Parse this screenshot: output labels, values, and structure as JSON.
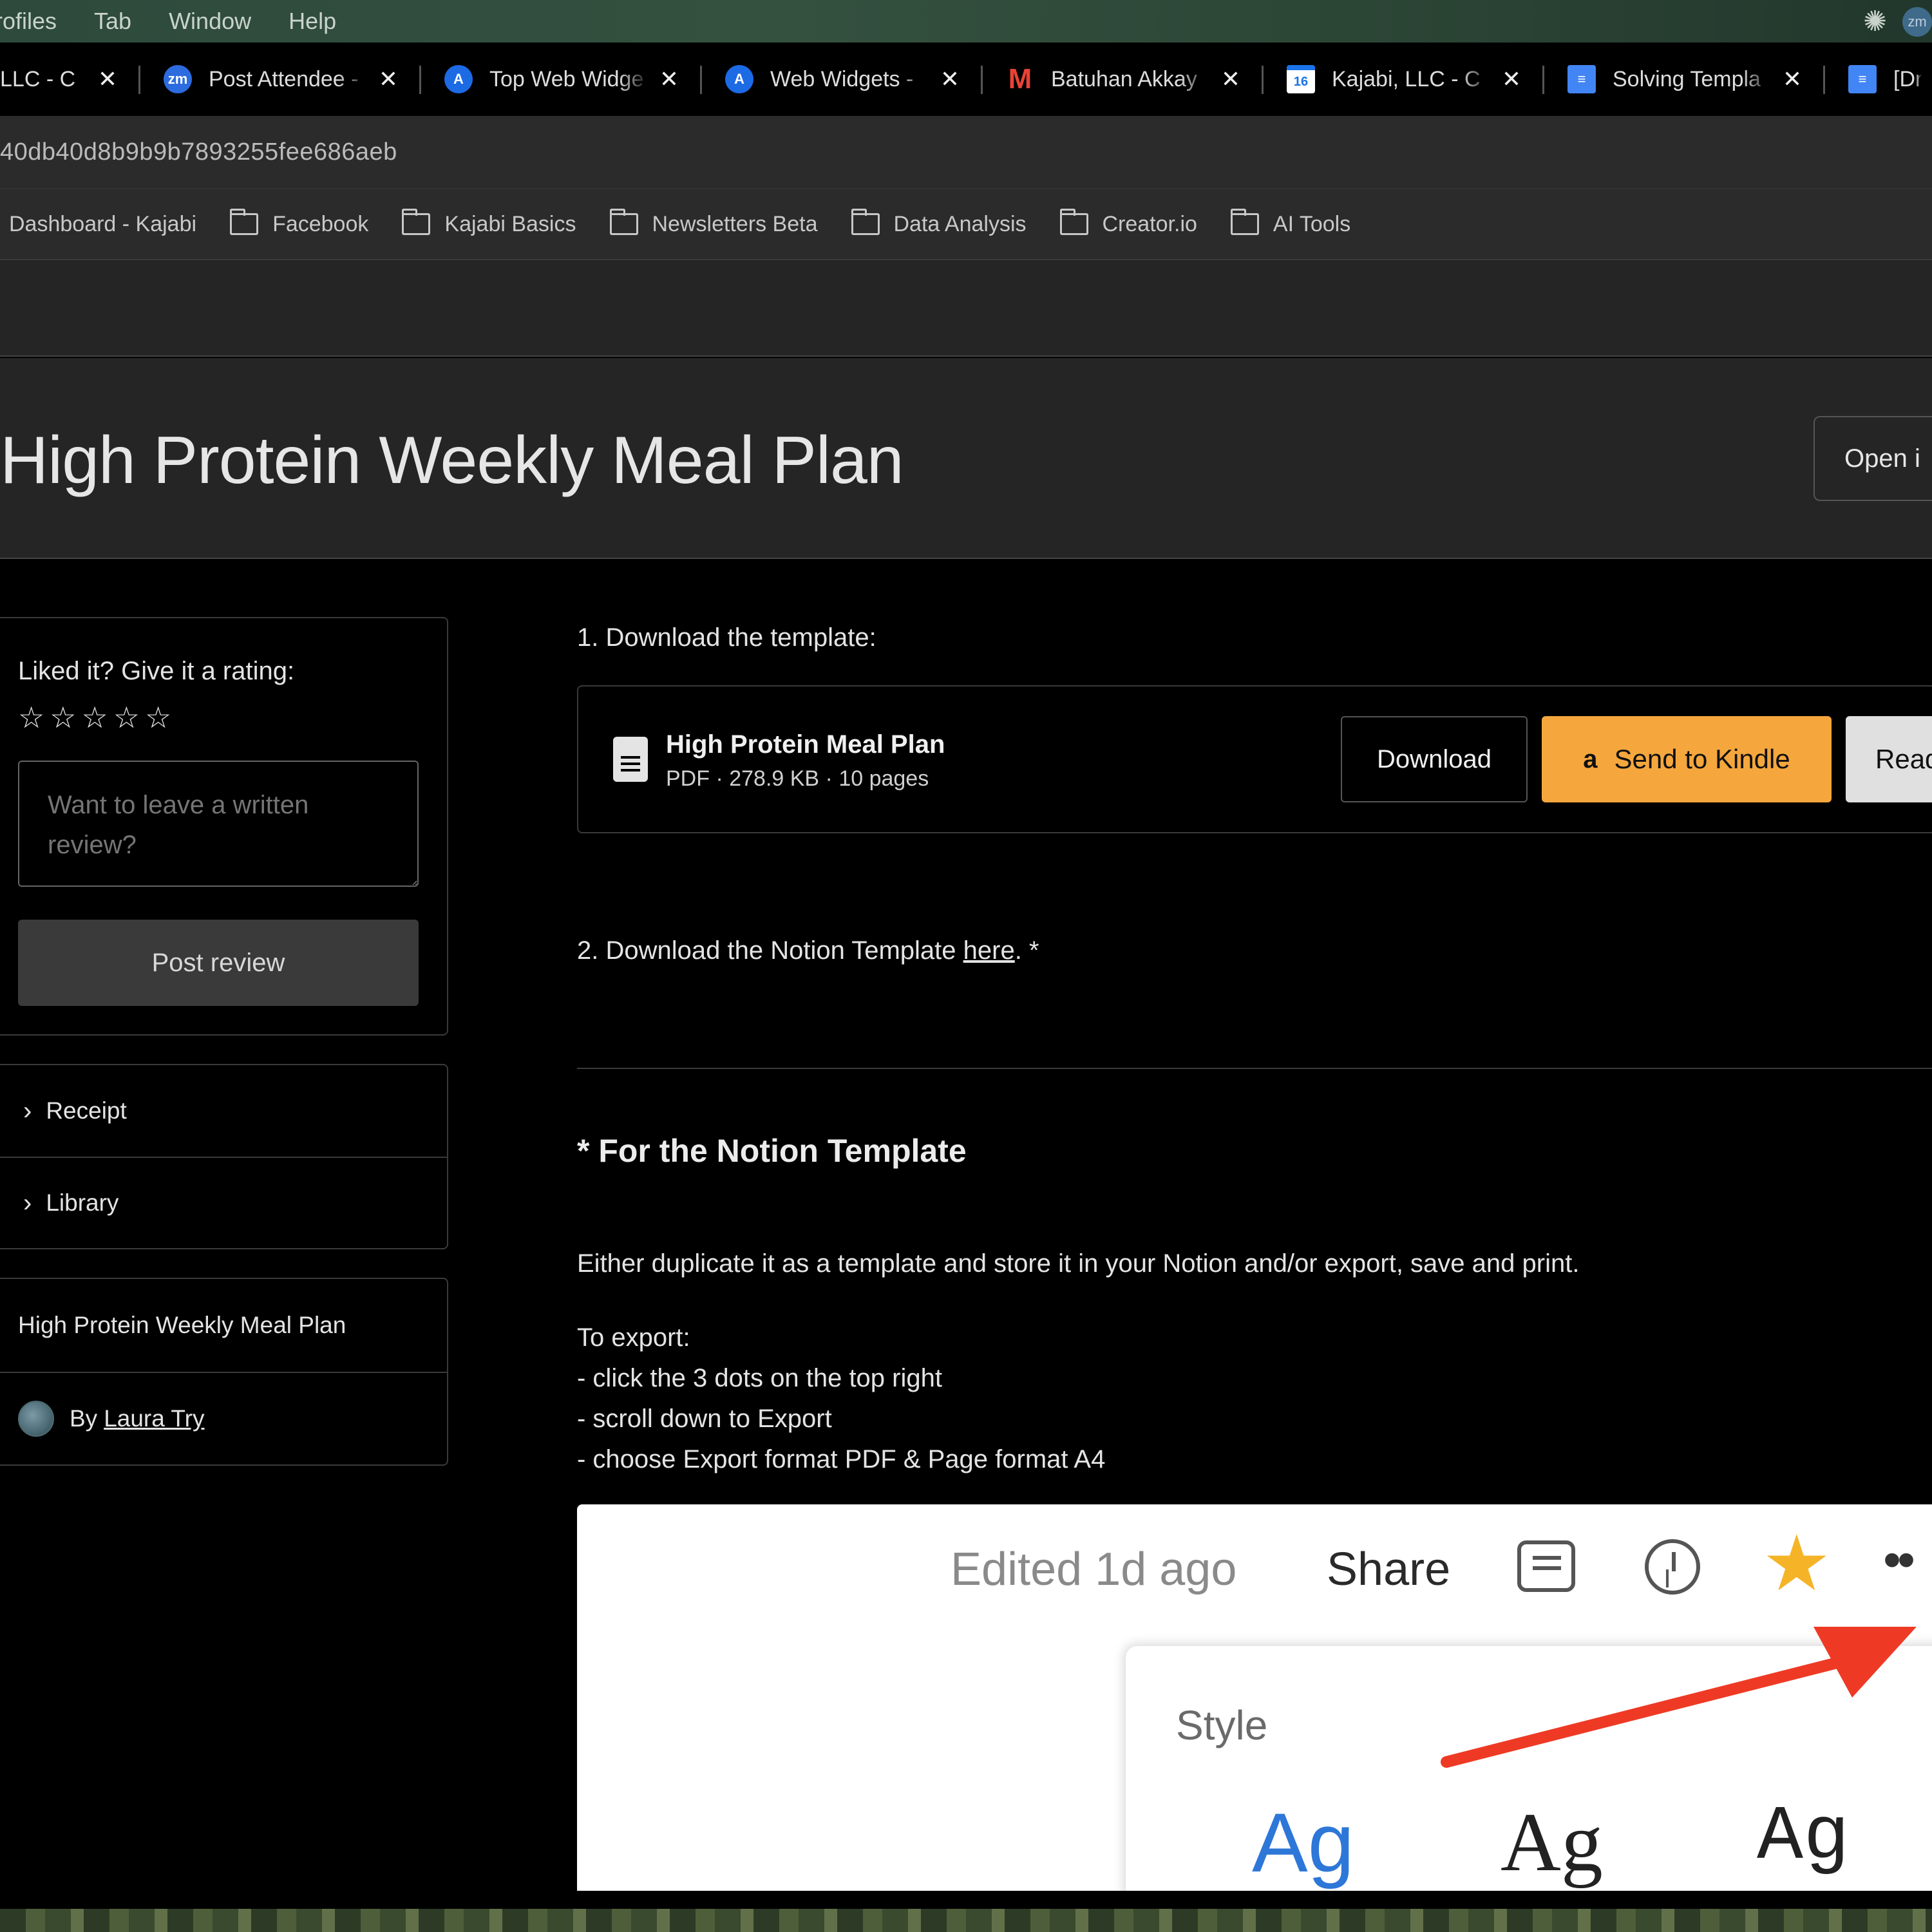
{
  "menubar": {
    "items": [
      "rofiles",
      "Tab",
      "Window",
      "Help"
    ],
    "avatar_label": "zm"
  },
  "tabs": [
    {
      "title": "LLC - C",
      "icon": "none"
    },
    {
      "title": "Post Attendee -",
      "icon": "zoom-icon",
      "icon_text": "zm"
    },
    {
      "title": "Top Web Widge",
      "icon": "app-store-icon",
      "icon_text": "A"
    },
    {
      "title": "Web Widgets -",
      "icon": "app-store-icon",
      "icon_text": "A"
    },
    {
      "title": "Batuhan Akkay",
      "icon": "gmail-icon",
      "icon_text": "M"
    },
    {
      "title": "Kajabi, LLC - C",
      "icon": "calendar-icon",
      "icon_text": "16"
    },
    {
      "title": "Solving Templa",
      "icon": "docs-icon",
      "icon_text": "≡"
    },
    {
      "title": "[Dra",
      "icon": "docs-icon",
      "icon_text": "≡"
    }
  ],
  "urlbar": {
    "url": "40db40d8b9b9b7893255fee686aeb"
  },
  "bookmarks": [
    {
      "label": "Dashboard - Kajabi",
      "folder": false
    },
    {
      "label": "Facebook",
      "folder": true
    },
    {
      "label": "Kajabi Basics",
      "folder": true
    },
    {
      "label": "Newsletters Beta",
      "folder": true
    },
    {
      "label": "Data Analysis",
      "folder": true
    },
    {
      "label": "Creator.io",
      "folder": true
    },
    {
      "label": "AI Tools",
      "folder": true
    }
  ],
  "page": {
    "title": "High Protein Weekly Meal Plan",
    "open_button": "Open i"
  },
  "sidebar": {
    "rating_label": "Liked it? Give it a rating:",
    "rating": {
      "value": 0,
      "max": 5
    },
    "review_placeholder": "Want to leave a written review?",
    "post_review": "Post review",
    "accordion": [
      "Receipt",
      "Library"
    ],
    "product_name": "High Protein Weekly Meal Plan",
    "by_label": "By",
    "author": "Laura Try"
  },
  "main": {
    "step1": "1. Download the template:",
    "file": {
      "name": "High Protein Meal Plan",
      "meta": "PDF · 278.9 KB · 10 pages"
    },
    "buttons": {
      "download": "Download",
      "kindle": "Send to Kindle",
      "kindle_icon": "a",
      "read": "Read"
    },
    "step2_prefix": "2. Download the Notion Template ",
    "step2_link": "here",
    "step2_suffix": ". *",
    "notion_heading": "* For the Notion Template",
    "paragraph": "Either duplicate it as a template and store it in your Notion and/or export, save and print.",
    "export_lines": [
      "To export:",
      "- click the 3 dots on the top right",
      "- scroll down to Export",
      "- choose Export format PDF & Page format A4"
    ]
  },
  "screenshot": {
    "edited": "Edited 1d ago",
    "share": "Share",
    "style_label": "Style",
    "ag": [
      "Ag",
      "Ag",
      "Ag"
    ],
    "arrow_color": "#ee3a25",
    "star_color": "#f5b428"
  },
  "colors": {
    "accent_kindle": "#f5a73d"
  }
}
